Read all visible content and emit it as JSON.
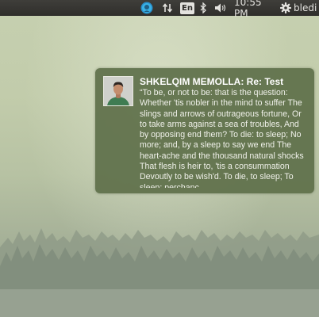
{
  "panel": {
    "input_language": "En",
    "clock": "10:55 PM",
    "user_name": "bledi",
    "icons": [
      "messaging-indicator-icon",
      "network-updown-icon",
      "keyboard-language-icon",
      "bluetooth-icon",
      "volume-icon",
      "gear-icon"
    ]
  },
  "notification": {
    "title": "SHKELQIM MEMOLLA: Re: Test",
    "body": "“To be, or not to be: that is the question: Whether 'tis nobler in the mind to suffer The slings and arrows of outrageous fortune, Or to take arms against a sea of troubles, And by opposing end them? To die: to sleep; No more; and, by a sleep to say we end The heart-ache and the thousand natural shocks That flesh is heir to, 'tis a consummation Devoutly to be wish'd. To die, to sleep; To sleep: perchanc…",
    "background_color": "#5f704a"
  }
}
